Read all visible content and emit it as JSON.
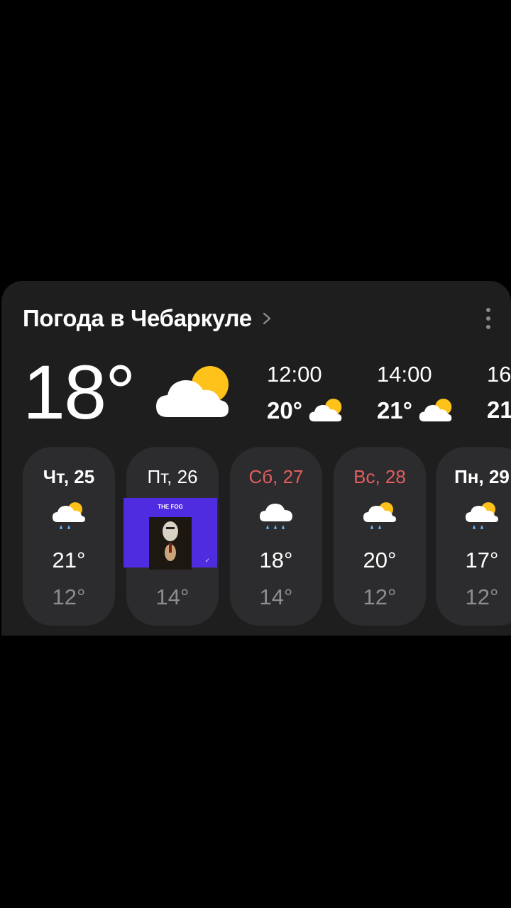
{
  "widget": {
    "title": "Погода в Чебаркуле",
    "current": {
      "temp": "18°",
      "icon": "partly-cloudy-icon"
    },
    "hourly": [
      {
        "time": "12:00",
        "temp": "20°",
        "icon": "partly-cloudy-icon"
      },
      {
        "time": "14:00",
        "temp": "21°",
        "icon": "partly-cloudy-icon"
      },
      {
        "time": "16",
        "temp": "21"
      }
    ],
    "daily": [
      {
        "name": "Чт, 25",
        "hi": "21°",
        "lo": "12°",
        "icon": "rain-sun-icon",
        "weekend": false
      },
      {
        "name": "Пт, 26",
        "hi": "",
        "lo": "14°",
        "icon": "",
        "weekend": false
      },
      {
        "name": "Сб, 27",
        "hi": "18°",
        "lo": "14°",
        "icon": "rain-icon",
        "weekend": true
      },
      {
        "name": "Вс, 28",
        "hi": "20°",
        "lo": "12°",
        "icon": "rain-sun-icon",
        "weekend": true
      },
      {
        "name": "Пн, 29",
        "hi": "17°",
        "lo": "12°",
        "icon": "rain-sun-icon",
        "weekend": false
      }
    ]
  },
  "overlay": {
    "album_title": "THE FOG",
    "icon": "album-cover"
  },
  "colors": {
    "background": "#000000",
    "card": "#1e1e1f",
    "tile": "#2c2c2e",
    "weekend": "#e35e5e",
    "sun": "#ffc21a",
    "album": "#4f2ce0"
  }
}
